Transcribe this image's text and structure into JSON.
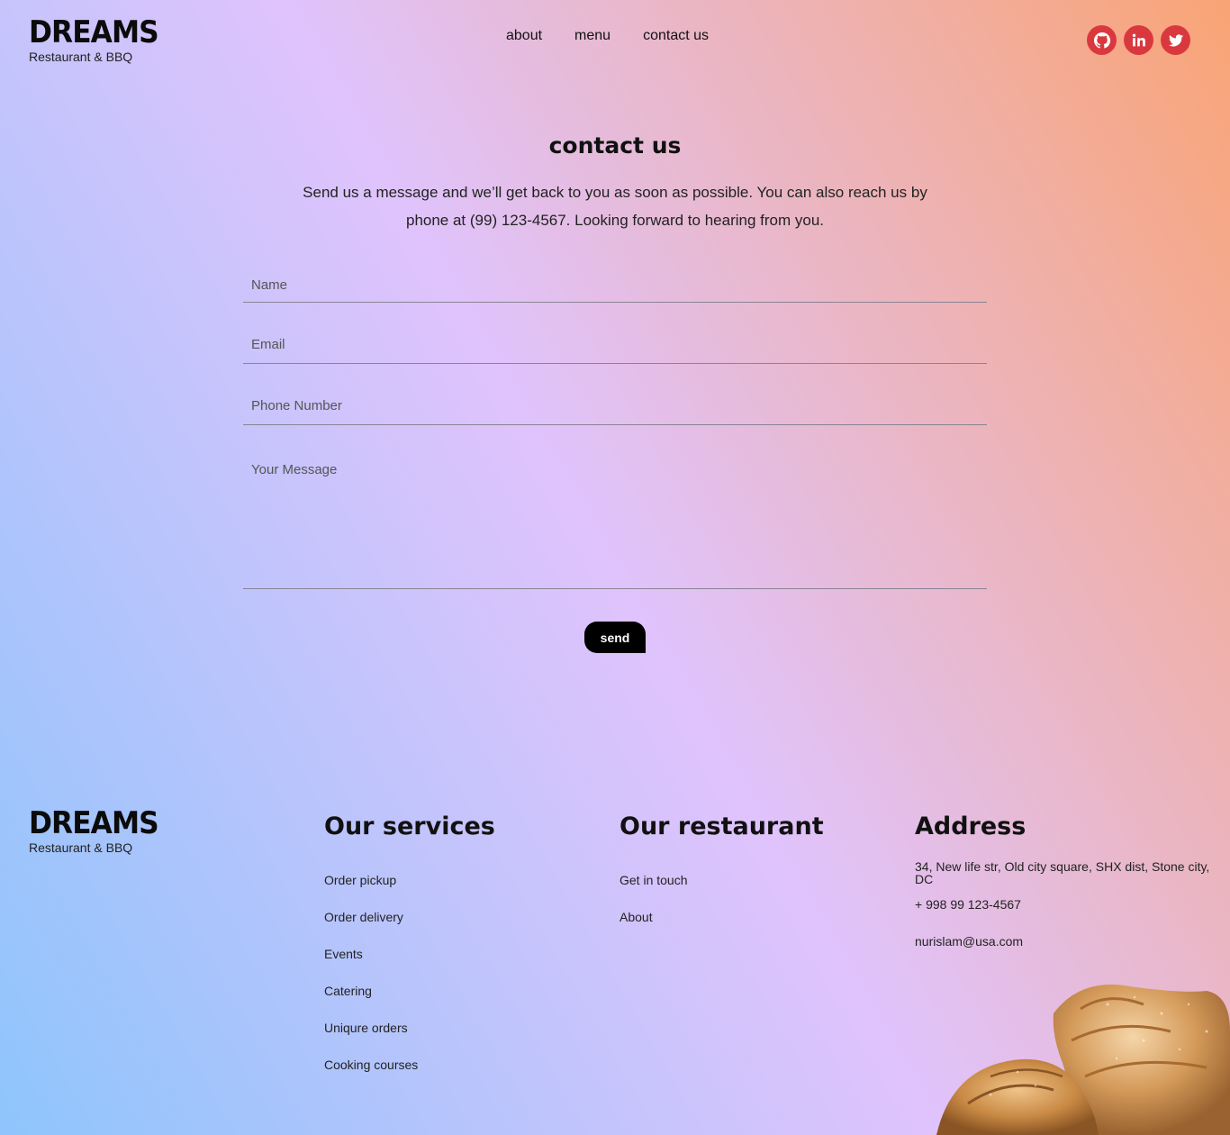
{
  "brand": {
    "name": "DREAMS",
    "tagline": "Restaurant & BBQ"
  },
  "nav": {
    "items": [
      "about",
      "menu",
      "contact us"
    ]
  },
  "socials": [
    {
      "icon": "github-icon",
      "color": "#d9393e"
    },
    {
      "icon": "linkedin-icon",
      "color": "#d9393e"
    },
    {
      "icon": "twitter-icon",
      "color": "#d9393e"
    }
  ],
  "contact": {
    "title": "contact us",
    "intro": "Send us a message and we’ll get back to you as soon as possible. You can also reach us by phone at (99) 123-4567. Looking forward to hearing from you.",
    "fields": {
      "name_placeholder": "Name",
      "email_placeholder": "Email",
      "phone_placeholder": "Phone Number",
      "message_placeholder": "Your Message"
    },
    "send_label": "send"
  },
  "footer": {
    "services": {
      "title": "Our services",
      "items": [
        "Order pickup",
        "Order delivery",
        "Events",
        "Catering",
        "Uniqure orders",
        "Cooking courses"
      ]
    },
    "restaurant": {
      "title": "Our restaurant",
      "items": [
        "Get in touch",
        "About"
      ]
    },
    "address": {
      "title": "Address",
      "street": "34, New life str, Old city square, SHX dist, Stone city, DC",
      "phone": "+ 998 99 123-4567",
      "email": "nurislam@usa.com"
    }
  },
  "colors": {
    "accent": "#d9393e",
    "button": "#000000"
  }
}
